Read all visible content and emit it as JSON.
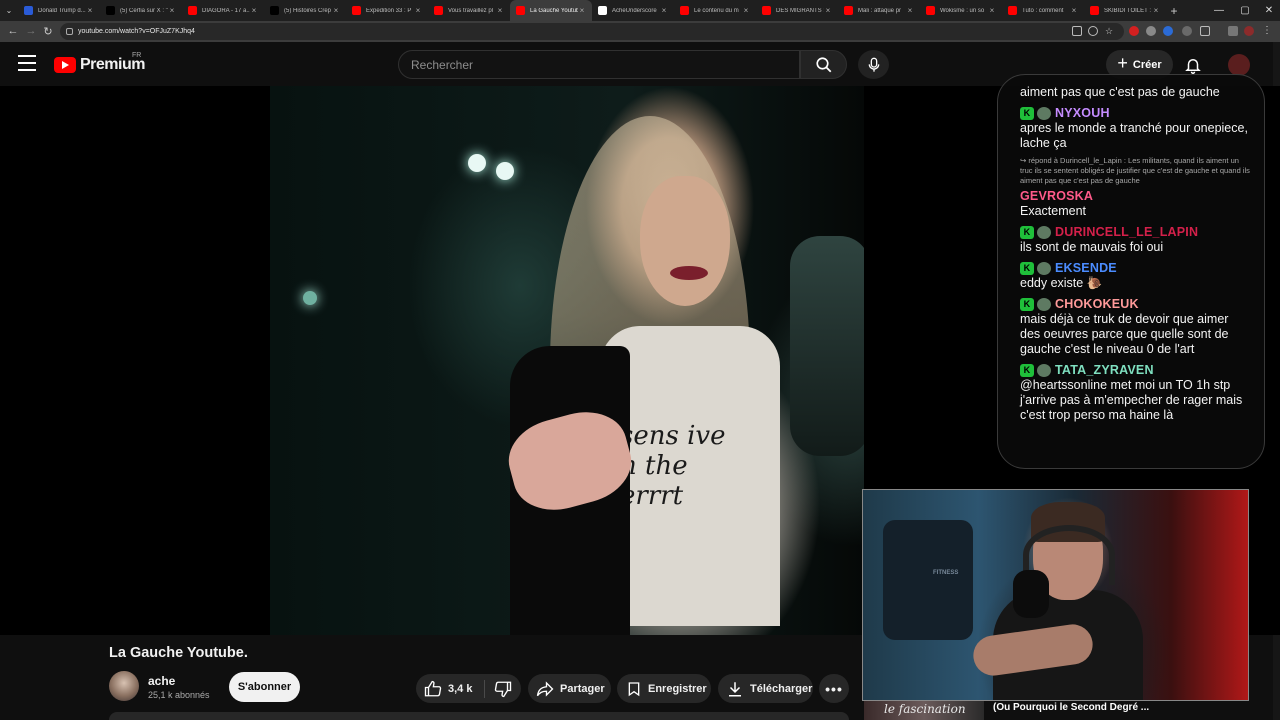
{
  "browser": {
    "tabs": [
      {
        "label": "Donald Trump d...",
        "fav": "#2a5bd7"
      },
      {
        "label": "(5) Cerfia sur X : \"",
        "fav": "#000000"
      },
      {
        "label": "DIAGORA - 17 a...",
        "fav": "#ff0000"
      },
      {
        "label": "(5) Histoires Crép",
        "fav": "#000000"
      },
      {
        "label": "Expedition 33 : P",
        "fav": "#ff0000"
      },
      {
        "label": "Vous travaillez pl",
        "fav": "#ff0000"
      },
      {
        "label": "La Gauche Youtub",
        "fav": "#ff0000"
      },
      {
        "label": "AcheUnderscore",
        "fav": "#ffffff"
      },
      {
        "label": "Le contenu du m",
        "fav": "#ff0000"
      },
      {
        "label": "DES MIGRANTS !",
        "fav": "#ff0000"
      },
      {
        "label": "Mali : attaque pr",
        "fav": "#ff0000"
      },
      {
        "label": "Wokisme : un so",
        "fav": "#ff0000"
      },
      {
        "label": "Tuto : comment",
        "fav": "#ff0000"
      },
      {
        "label": "SKIBIDI TOILET :",
        "fav": "#ff0000"
      }
    ],
    "active_tab": 6,
    "url": "youtube.com/watch?v=OFJuZ7KJhq4"
  },
  "header": {
    "logo_text": "Premium",
    "region": "FR",
    "search_placeholder": "Rechercher",
    "create_label": "Créer"
  },
  "chat": {
    "partial_top": "aiment pas que c'est pas de gauche",
    "messages": [
      {
        "user": "NYXOUH",
        "color": "#c58cff",
        "badges": true,
        "text": "apres le monde a tranché pour onepiece, lache ça"
      },
      {
        "user": "GEVROSKA",
        "color": "#ff5a8a",
        "badges": false,
        "reply": "↪ répond à Durincell_le_Lapin : Les militants, quand ils aiment un truc ils se sentent obligés de justifier que c'est de gauche et quand ils aiment pas que c'est pas de gauche",
        "text": "Exactement"
      },
      {
        "user": "DURINCELL_LE_LAPIN",
        "color": "#d4204a",
        "badges": true,
        "text": "ils sont de mauvais foi oui"
      },
      {
        "user": "EKSENDE",
        "color": "#4b8cff",
        "badges": true,
        "text": "eddy existe 🐌"
      },
      {
        "user": "CHOKOKEUK",
        "color": "#ff9a9a",
        "badges": true,
        "text": "mais déjà ce truk de devoir que aimer des oeuvres parce que quelle sont de gauche c'est le niveau 0 de l'art"
      },
      {
        "user": "TATA_ZYRAVEN",
        "color": "#7fe0c0",
        "badges": true,
        "text": "@heartssonline met moi un TO 1h stp j'arrive pas à m'empecher de rager mais c'est trop perso ma haine là"
      }
    ]
  },
  "video": {
    "shirt_text": "sens ive\nn the\nerrrt",
    "title": "La Gauche Youtube.",
    "channel": "ache",
    "subscribers": "25,1 k abonnés",
    "subscribe_label": "S'abonner",
    "likes": "3,4 k",
    "share_label": "Partager",
    "save_label": "Enregistrer",
    "download_label": "Télécharger",
    "more_label": "•••"
  },
  "webcam": {
    "chair_label": "FITNESS"
  },
  "overlay": {
    "thumb_text": "le fascination",
    "title": "(Ou Pourquoi le Second Degré ..."
  }
}
